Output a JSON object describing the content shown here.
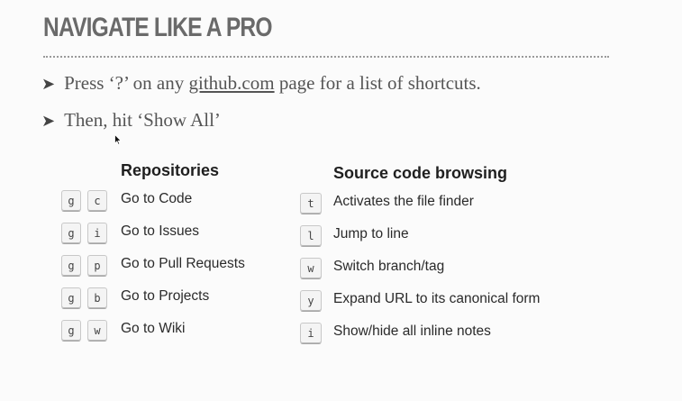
{
  "slide": {
    "title": "NAVIGATE LIKE A PRO",
    "bullets": [
      {
        "arrow": "➤",
        "before": "Press ‘?’ on any ",
        "link": "github.com",
        "after": " page for a list of shortcuts."
      },
      {
        "arrow": "➤",
        "text": "Then, hit ‘Show All’"
      }
    ]
  },
  "repositories": {
    "title": "Repositories",
    "rows": [
      {
        "keys": [
          "g",
          "c"
        ],
        "label": "Go to Code"
      },
      {
        "keys": [
          "g",
          "i"
        ],
        "label": "Go to Issues"
      },
      {
        "keys": [
          "g",
          "p"
        ],
        "label": "Go to Pull Requests"
      },
      {
        "keys": [
          "g",
          "b"
        ],
        "label": "Go to Projects"
      },
      {
        "keys": [
          "g",
          "w"
        ],
        "label": "Go to Wiki"
      }
    ]
  },
  "source": {
    "title": "Source code browsing",
    "rows": [
      {
        "key": "t",
        "label": "Activates the file finder"
      },
      {
        "key": "l",
        "label": "Jump to line"
      },
      {
        "key": "w",
        "label": "Switch branch/tag"
      },
      {
        "key": "y",
        "label": "Expand URL to its canonical form"
      },
      {
        "key": "i",
        "label": "Show/hide all inline notes"
      }
    ]
  },
  "icons": {
    "bullet": "arrow-bullet-icon",
    "cursor": "mouse-pointer-icon"
  }
}
